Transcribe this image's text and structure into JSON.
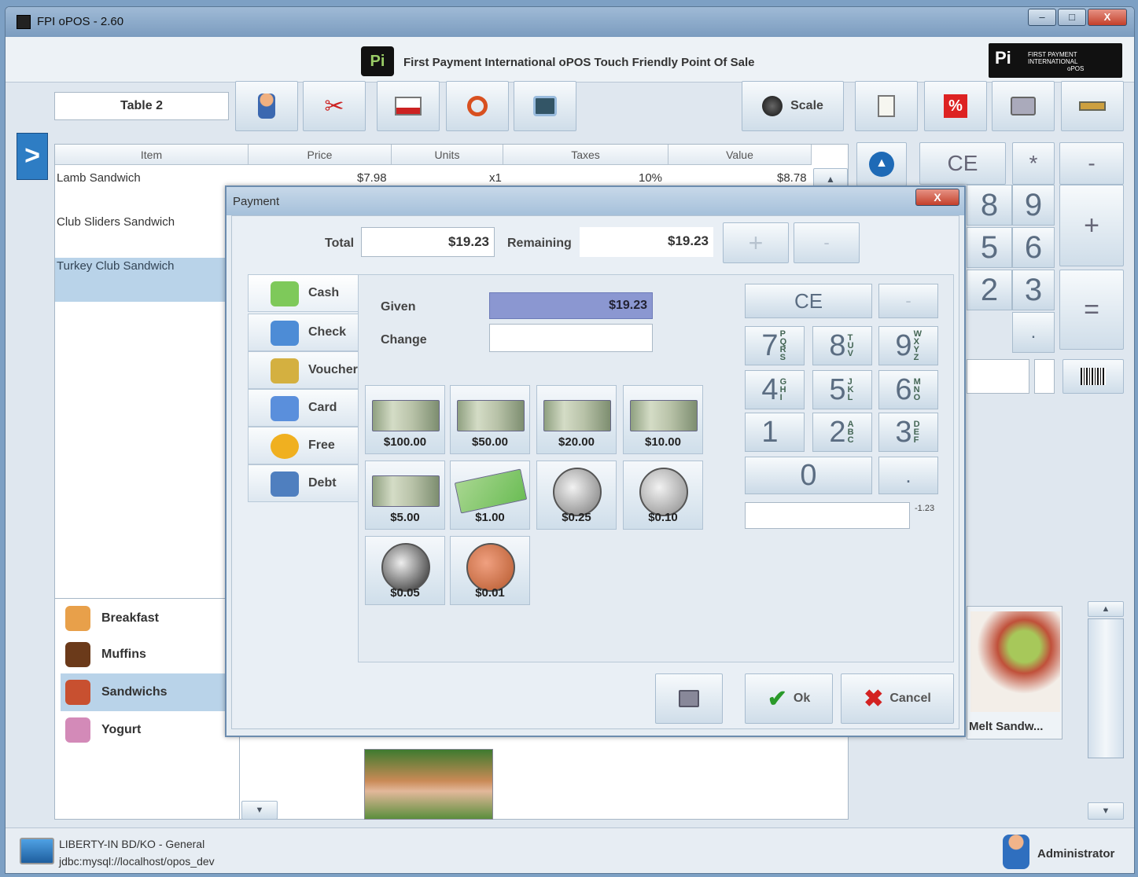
{
  "window": {
    "title": "FPI oPOS - 2.60",
    "min": "‒",
    "max": "□",
    "close": "X"
  },
  "banner": {
    "text": "First Payment International oPOS   Touch Friendly Point Of Sale",
    "logo_text": "FIRST PAYMENT INTERNATIONAL",
    "logo_sub": "oPOS",
    "logo_mark": "Pi"
  },
  "toolbar": {
    "table": "Table 2",
    "scale": "Scale"
  },
  "ticket": {
    "headers": [
      "Item",
      "Price",
      "Units",
      "Taxes",
      "Value"
    ],
    "rows": [
      {
        "item": "Lamb  Sandwich",
        "price": "$7.98",
        "units": "x1",
        "taxes": "10%",
        "value": "$8.78"
      },
      {
        "item": "Club Sliders  Sandwich",
        "price": "",
        "units": "",
        "taxes": "",
        "value": ""
      },
      {
        "item": "Turkey Club  Sandwich",
        "price": "",
        "units": "",
        "taxes": "",
        "value": ""
      }
    ],
    "nav_arrow": ">"
  },
  "keypad_bg": {
    "ce": "CE",
    "mult": "*",
    "minus": "-",
    "plus": "+",
    "eq": "=",
    "dot": ".",
    "d8": "8",
    "d9": "9",
    "d5": "5",
    "d6": "6",
    "d2": "2",
    "d3": "3"
  },
  "categories": [
    {
      "label": "Breakfast",
      "color": "#e8a04a"
    },
    {
      "label": "Muffins",
      "color": "#6b3a1a"
    },
    {
      "label": "Sandwichs",
      "color": "#c85030"
    },
    {
      "label": "Yogurt",
      "color": "#d38ab8"
    }
  ],
  "products": {
    "melt": "Melt  Sandw..."
  },
  "status": {
    "line1": "LIBERTY-IN BD/KO - General",
    "line2": "jdbc:mysql://localhost/opos_dev",
    "user": "Administrator"
  },
  "payment": {
    "title": "Payment",
    "total_label": "Total",
    "total": "$19.23",
    "remaining_label": "Remaining",
    "remaining": "$19.23",
    "plus": "+",
    "minus": "-",
    "tabs": [
      {
        "label": "Cash",
        "color": "#7ec95a"
      },
      {
        "label": "Check",
        "color": "#4d8cd6"
      },
      {
        "label": "Voucher",
        "color": "#d4b040"
      },
      {
        "label": "Card",
        "color": "#5a8fdc"
      },
      {
        "label": "Free",
        "color": "#f0b020"
      },
      {
        "label": "Debt",
        "color": "#4f7fbf"
      }
    ],
    "given_label": "Given",
    "given": "$19.23",
    "change_label": "Change",
    "change": "",
    "money": [
      {
        "label": "$100.00",
        "kind": "bill"
      },
      {
        "label": "$50.00",
        "kind": "bill"
      },
      {
        "label": "$20.00",
        "kind": "bill"
      },
      {
        "label": "$10.00",
        "kind": "bill"
      },
      {
        "label": "$5.00",
        "kind": "bill"
      },
      {
        "label": "$1.00",
        "kind": "bill"
      },
      {
        "label": "$0.25",
        "kind": "coin"
      },
      {
        "label": "$0.10",
        "kind": "coin"
      },
      {
        "label": "$0.05",
        "kind": "coin"
      },
      {
        "label": "$0.01",
        "kind": "coin"
      }
    ],
    "keypad": {
      "ce": "CE",
      "minus": "-",
      "zero": "0",
      "dot": "."
    },
    "keys": [
      {
        "d": "7",
        "s": "PQRS"
      },
      {
        "d": "8",
        "s": "TUV"
      },
      {
        "d": "9",
        "s": "WXYZ"
      },
      {
        "d": "4",
        "s": "GHI"
      },
      {
        "d": "5",
        "s": "JKL"
      },
      {
        "d": "6",
        "s": "MNO"
      },
      {
        "d": "1",
        "s": ""
      },
      {
        "d": "2",
        "s": "ABC"
      },
      {
        "d": "3",
        "s": "DEF"
      }
    ],
    "display_value": "-1.23",
    "ok": "Ok",
    "cancel": "Cancel"
  }
}
